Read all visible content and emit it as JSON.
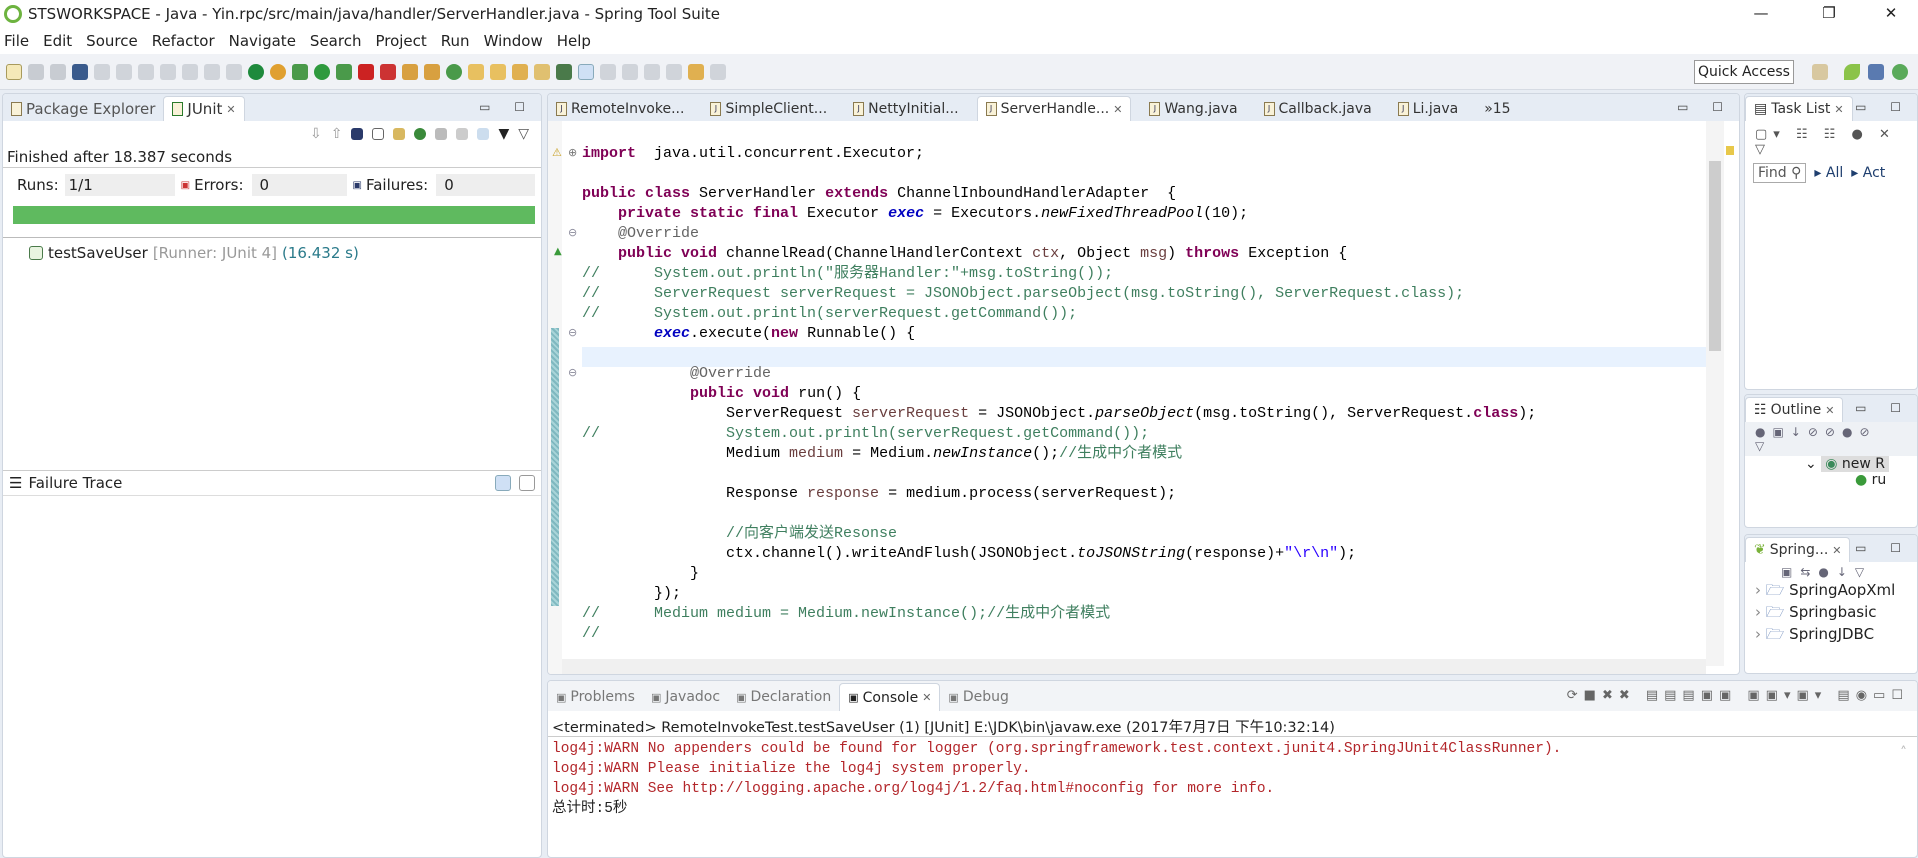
{
  "window": {
    "title": "STSWORKSPACE - Java - Yin.rpc/src/main/java/handler/ServerHandler.java - Spring Tool Suite",
    "minimize": "—",
    "restore": "❐",
    "close": "✕"
  },
  "menu": [
    "File",
    "Edit",
    "Source",
    "Refactor",
    "Navigate",
    "Search",
    "Project",
    "Run",
    "Window",
    "Help"
  ],
  "toolbar": {
    "quick_access": "Quick Access"
  },
  "left": {
    "tabs": [
      {
        "label": "Package Explorer"
      },
      {
        "label": "JUnit"
      }
    ],
    "status": "Finished after 18.387 seconds",
    "runs_label": "Runs:",
    "runs": "1/1",
    "errors_label": "Errors:",
    "errors": "0",
    "failures_label": "Failures:",
    "failures": "0",
    "progress": 1.0,
    "progress_color": "#5fba5f",
    "test": {
      "name": "testSaveUser",
      "runner": "[Runner: JUnit 4]",
      "time": "(16.432 s)"
    },
    "failure_trace": "Failure Trace"
  },
  "editor": {
    "tabs": [
      {
        "label": "RemoteInvoke..."
      },
      {
        "label": "SimpleClient..."
      },
      {
        "label": "NettyInitial..."
      },
      {
        "label": "ServerHandle...",
        "active": true
      },
      {
        "label": "Wang.java"
      },
      {
        "label": "Callback.java"
      },
      {
        "label": "Li.java"
      }
    ],
    "overflow": "»15",
    "lines": [
      [
        [
          "kw",
          "import"
        ],
        [
          "",
          "  java.util.concurrent.Executor;"
        ]
      ],
      [],
      [
        [
          "kw",
          "public class"
        ],
        [
          "",
          " ServerHandler "
        ],
        [
          "kw",
          "extends"
        ],
        [
          "",
          " ChannelInboundHandlerAdapter  {"
        ]
      ],
      [
        [
          "",
          "    "
        ],
        [
          "kw",
          "private static final"
        ],
        [
          "",
          " Executor "
        ],
        [
          "fd",
          "exec"
        ],
        [
          "",
          " = Executors."
        ],
        [
          "it",
          "newFixedThreadPool"
        ],
        [
          "",
          "(10);"
        ]
      ],
      [
        [
          "an",
          "    @Override"
        ]
      ],
      [
        [
          "",
          "    "
        ],
        [
          "kw",
          "public void"
        ],
        [
          "",
          " channelRead(ChannelHandlerContext "
        ],
        [
          "lv",
          "ctx"
        ],
        [
          "",
          ", Object "
        ],
        [
          "lv",
          "msg"
        ],
        [
          "",
          ") "
        ],
        [
          "kw",
          "throws"
        ],
        [
          "",
          " Exception {"
        ]
      ],
      [
        [
          "cm",
          "//      System.out.println(\"服务器Handler:\"+msg.toString());"
        ]
      ],
      [
        [
          "cm",
          "//      ServerRequest serverRequest = JSONObject.parseObject(msg.toString(), ServerRequest.class);"
        ]
      ],
      [
        [
          "cm",
          "//      System.out.println(serverRequest.getCommand());"
        ]
      ],
      [
        [
          "",
          "        "
        ],
        [
          "fd",
          "exec"
        ],
        [
          "",
          ".execute("
        ],
        [
          "kw",
          "new"
        ],
        [
          "",
          " Runnable() {"
        ]
      ],
      [],
      [
        [
          "an",
          "            @Override"
        ]
      ],
      [
        [
          "",
          "            "
        ],
        [
          "kw",
          "public void"
        ],
        [
          "",
          " run() {"
        ]
      ],
      [
        [
          "",
          "                ServerRequest "
        ],
        [
          "lv",
          "serverRequest"
        ],
        [
          "",
          " = JSONObject."
        ],
        [
          "it",
          "parseObject"
        ],
        [
          "",
          "(msg.toString(), ServerRequest."
        ],
        [
          "kw",
          "class"
        ],
        [
          "",
          ");"
        ]
      ],
      [
        [
          "cm",
          "//              System.out.println(serverRequest.getCommand());"
        ]
      ],
      [
        [
          "",
          "                Medium "
        ],
        [
          "lv",
          "medium"
        ],
        [
          "",
          " = Medium."
        ],
        [
          "it",
          "newInstance"
        ],
        [
          "",
          "();"
        ],
        [
          "cm",
          "//生成中介者模式"
        ]
      ],
      [],
      [
        [
          "",
          "                Response "
        ],
        [
          "lv",
          "response"
        ],
        [
          "",
          " = medium.process(serverRequest);"
        ]
      ],
      [],
      [
        [
          "cm",
          "                //向客户端发送Resonse"
        ]
      ],
      [
        [
          "",
          "                ctx.channel().writeAndFlush(JSONObject."
        ],
        [
          "it",
          "toJSONString"
        ],
        [
          "",
          "(response)+"
        ],
        [
          "st",
          "\"\\r\\n\""
        ],
        [
          "",
          ");"
        ]
      ],
      [
        [
          "",
          "            }"
        ]
      ],
      [
        [
          "",
          "        });"
        ]
      ],
      [
        [
          "cm",
          "//      Medium medium = Medium.newInstance();//生成中介者模式"
        ]
      ],
      [
        [
          "cm",
          "//"
        ]
      ]
    ]
  },
  "right": {
    "task_list": {
      "title": "Task List",
      "find": "Find",
      "all": "All",
      "activate": "Act"
    },
    "outline": {
      "title": "Outline",
      "item1": "new R",
      "item2": "ru"
    },
    "spring": {
      "title": "Spring...",
      "items": [
        "SpringAopXml",
        "Springbasic",
        "SpringJDBC"
      ]
    }
  },
  "console": {
    "tabs": [
      {
        "label": "Problems"
      },
      {
        "label": "Javadoc"
      },
      {
        "label": "Declaration"
      },
      {
        "label": "Console",
        "active": true
      },
      {
        "label": "Debug"
      }
    ],
    "header": "<terminated> RemoteInvokeTest.testSaveUser (1) [JUnit] E:\\JDK\\bin\\javaw.exe (2017年7月7日 下午10:32:14)",
    "lines": [
      {
        "text": "log4j:WARN No appenders could be found for logger (org.springframework.test.context.junit4.SpringJUnit4ClassRunner).",
        "err": true
      },
      {
        "text": "log4j:WARN Please initialize the log4j system properly.",
        "err": true
      },
      {
        "text": "log4j:WARN See http://logging.apache.org/log4j/1.2/faq.html#noconfig for more info.",
        "err": true
      },
      {
        "text": "总计时:5秒",
        "err": false
      }
    ]
  }
}
